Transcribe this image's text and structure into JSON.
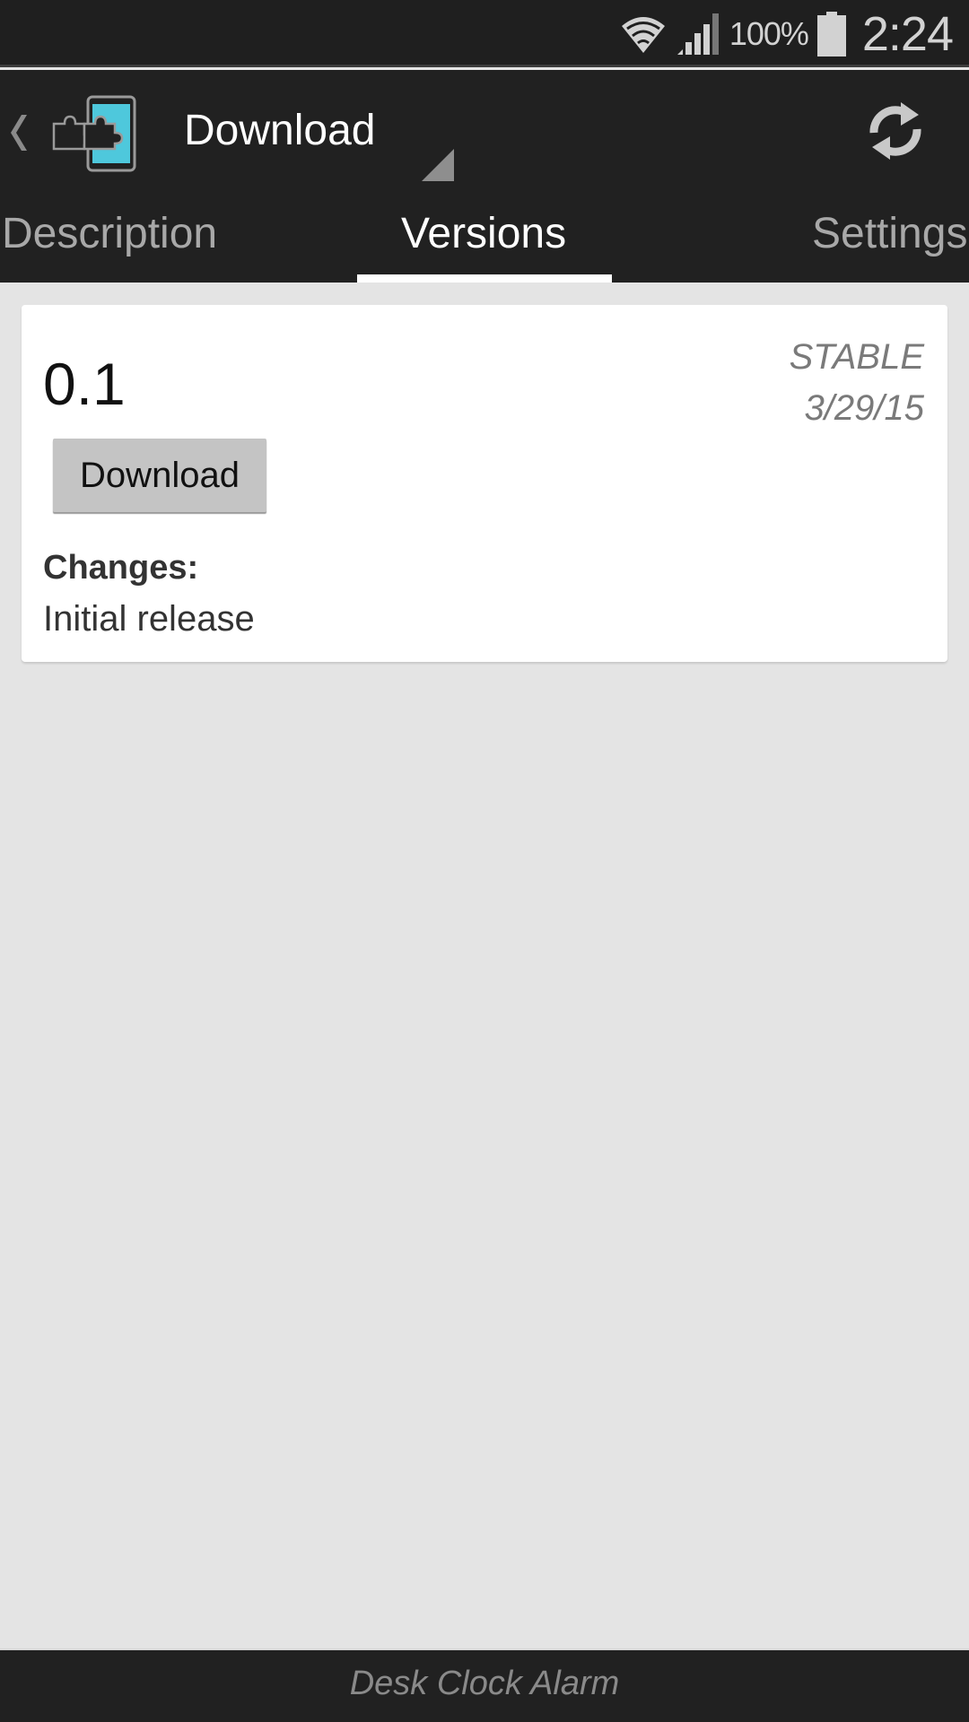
{
  "status_bar": {
    "battery_percent": "100%",
    "time": "2:24",
    "icons": [
      "wifi-icon",
      "signal-icon",
      "battery-icon"
    ]
  },
  "action_bar": {
    "title": "Download",
    "icons": [
      "back-chevron-icon",
      "xposed-app-icon",
      "spinner-dropdown-icon",
      "refresh-icon"
    ]
  },
  "tabs": [
    {
      "label": "Description",
      "selected": false
    },
    {
      "label": "Versions",
      "selected": true
    },
    {
      "label": "Settings",
      "selected": false
    }
  ],
  "versions": [
    {
      "version": "0.1",
      "channel": "STABLE",
      "date": "3/29/15",
      "download_label": "Download",
      "changes_label": "Changes:",
      "changes_text": "Initial release"
    }
  ],
  "footer": {
    "text": "Desk Clock Alarm"
  },
  "colors": {
    "bar_bg": "#212121",
    "content_bg": "#e4e4e4",
    "accent_cyan": "#4ec8dc",
    "tab_indicator": "#ffffff"
  }
}
